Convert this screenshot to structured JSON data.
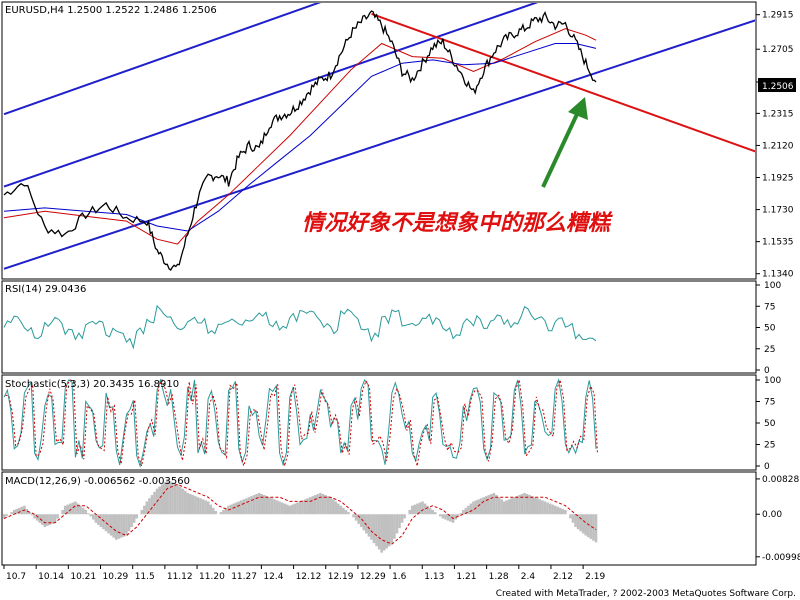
{
  "chart_data": [
    {
      "type": "candlestick",
      "title": "EURUSD,H4  1.2500 1.2522 1.2486 1.2506",
      "symbol": "EURUSD",
      "timeframe": "H4",
      "ohlc_last": {
        "open": 1.25,
        "high": 1.2522,
        "low": 1.2486,
        "close": 1.2506
      },
      "current_price_label": "1.2506",
      "current_price": 1.2506,
      "y_ticks": [
        "1.2915",
        "1.2705",
        "1.2506",
        "1.2315",
        "1.2120",
        "1.1925",
        "1.1730",
        "1.1535",
        "1.1340"
      ],
      "y_tick_values": [
        1.2915,
        1.2705,
        1.2506,
        1.2315,
        1.212,
        1.1925,
        1.173,
        1.1535,
        1.134
      ],
      "ylim": [
        1.132,
        1.298
      ],
      "x_ticks": [
        "10.7",
        "10.14",
        "10.21",
        "10.29",
        "11.5",
        "11.12",
        "11.20",
        "11.27",
        "12.4",
        "12.12",
        "12.19",
        "12.29",
        "1.6",
        "1.13",
        "1.21",
        "1.28",
        "2.4",
        "2.12",
        "2.19"
      ],
      "close_path": [
        [
          0,
          1.182
        ],
        [
          2,
          1.19
        ],
        [
          4,
          1.162
        ],
        [
          6,
          1.158
        ],
        [
          8,
          1.17
        ],
        [
          10,
          1.176
        ],
        [
          12,
          1.168
        ],
        [
          14,
          1.166
        ],
        [
          15,
          1.148
        ],
        [
          16,
          1.14
        ],
        [
          17,
          1.137
        ],
        [
          18,
          1.158
        ],
        [
          19,
          1.18
        ],
        [
          20,
          1.193
        ],
        [
          21,
          1.194
        ],
        [
          22,
          1.19
        ],
        [
          23,
          1.205
        ],
        [
          24,
          1.212
        ],
        [
          25,
          1.21
        ],
        [
          26,
          1.225
        ],
        [
          27,
          1.23
        ],
        [
          28,
          1.232
        ],
        [
          29,
          1.238
        ],
        [
          30,
          1.246
        ],
        [
          31,
          1.252
        ],
        [
          32,
          1.255
        ],
        [
          33,
          1.268
        ],
        [
          34,
          1.28
        ],
        [
          35,
          1.287
        ],
        [
          36,
          1.292
        ],
        [
          37,
          1.285
        ],
        [
          38,
          1.274
        ],
        [
          39,
          1.257
        ],
        [
          40,
          1.252
        ],
        [
          41,
          1.262
        ],
        [
          42,
          1.272
        ],
        [
          43,
          1.275
        ],
        [
          44,
          1.264
        ],
        [
          45,
          1.254
        ],
        [
          46,
          1.244
        ],
        [
          47,
          1.258
        ],
        [
          48,
          1.269
        ],
        [
          49,
          1.276
        ],
        [
          50,
          1.28
        ],
        [
          51,
          1.283
        ],
        [
          52,
          1.288
        ],
        [
          53,
          1.29
        ],
        [
          54,
          1.285
        ],
        [
          55,
          1.286
        ],
        [
          56,
          1.275
        ],
        [
          57,
          1.262
        ],
        [
          58,
          1.2506
        ]
      ],
      "ma_red": [
        [
          0,
          1.168
        ],
        [
          4,
          1.172
        ],
        [
          8,
          1.169
        ],
        [
          12,
          1.166
        ],
        [
          15,
          1.155
        ],
        [
          17,
          1.152
        ],
        [
          19,
          1.166
        ],
        [
          22,
          1.182
        ],
        [
          25,
          1.2
        ],
        [
          28,
          1.218
        ],
        [
          31,
          1.238
        ],
        [
          34,
          1.258
        ],
        [
          37,
          1.274
        ],
        [
          40,
          1.266
        ],
        [
          43,
          1.265
        ],
        [
          46,
          1.257
        ],
        [
          49,
          1.265
        ],
        [
          52,
          1.275
        ],
        [
          55,
          1.283
        ],
        [
          57,
          1.279
        ],
        [
          58,
          1.276
        ]
      ],
      "ma_blue": [
        [
          0,
          1.172
        ],
        [
          4,
          1.174
        ],
        [
          8,
          1.172
        ],
        [
          12,
          1.17
        ],
        [
          15,
          1.163
        ],
        [
          18,
          1.16
        ],
        [
          21,
          1.172
        ],
        [
          24,
          1.188
        ],
        [
          27,
          1.203
        ],
        [
          30,
          1.218
        ],
        [
          33,
          1.236
        ],
        [
          36,
          1.254
        ],
        [
          39,
          1.262
        ],
        [
          42,
          1.264
        ],
        [
          45,
          1.261
        ],
        [
          48,
          1.262
        ],
        [
          51,
          1.268
        ],
        [
          54,
          1.274
        ],
        [
          56,
          1.274
        ],
        [
          58,
          1.271
        ]
      ],
      "trend_channel_blue": {
        "lower": [
          [
            0,
            1.137
          ],
          [
            76,
            1.293
          ]
        ],
        "middle": [
          [
            0,
            1.187
          ],
          [
            76,
            1.35
          ]
        ],
        "upper": [
          [
            0,
            1.231
          ],
          [
            76,
            1.398
          ]
        ]
      },
      "trend_line_red": [
        [
          36,
          1.292
        ],
        [
          76,
          1.203
        ]
      ],
      "annotation": "情况好象不是想象中的那么糟糕",
      "arrow_color": "#2a8a2a",
      "colors": {
        "price": "#000000",
        "ma_red": "#cc0000",
        "ma_blue": "#0000cc",
        "channel": "#1f1fcc",
        "trend": "#dd1111",
        "annotation": "#e01010"
      }
    },
    {
      "type": "line",
      "title": "RSI(14) 29.0436",
      "name": "RSI(14)",
      "value": 29.0436,
      "y_ticks": [
        "100",
        "75",
        "50",
        "25",
        "0"
      ],
      "ylim": [
        0,
        100
      ],
      "values": [
        52,
        62,
        50,
        40,
        55,
        60,
        48,
        42,
        58,
        52,
        45,
        40,
        32,
        48,
        58,
        70,
        60,
        52,
        62,
        55,
        48,
        58,
        62,
        55,
        58,
        65,
        54,
        50,
        62,
        70,
        66,
        55,
        48,
        72,
        66,
        48,
        40,
        60,
        65,
        55,
        50,
        62,
        58,
        48,
        42,
        60,
        58,
        52,
        62,
        55,
        60,
        70,
        65,
        52,
        60,
        55,
        42,
        35,
        29
      ],
      "color": "#2a9a9a"
    },
    {
      "type": "line",
      "title": "Stochastic(5,3,3) 20.3435 16.8910",
      "name": "Stochastic(5,3,3)",
      "main": 20.3435,
      "signal": 16.891,
      "y_ticks": [
        "100",
        "75",
        "50",
        "25",
        "0"
      ],
      "ylim": [
        0,
        100
      ],
      "values": [
        80,
        20,
        85,
        15,
        70,
        25,
        90,
        10,
        75,
        30,
        85,
        18,
        60,
        12,
        40,
        88,
        70,
        22,
        92,
        15,
        78,
        28,
        88,
        20,
        70,
        35,
        90,
        15,
        80,
        25,
        60,
        88,
        45,
        15,
        70,
        90,
        30,
        20,
        85,
        60,
        15,
        40,
        80,
        25,
        10,
        70,
        90,
        20,
        85,
        30,
        88,
        15,
        75,
        40,
        90,
        25,
        15,
        80,
        20
      ],
      "colors": {
        "main": "#2a9a9a",
        "signal": "#cc0000"
      }
    },
    {
      "type": "bar",
      "title": "MACD(12,26,9) -0.006562 -0.003560",
      "name": "MACD(12,26,9)",
      "macd": -0.006562,
      "signal": -0.00356,
      "y_ticks": [
        "0.00828",
        "0.00",
        "-0.00998"
      ],
      "ylim": [
        -0.0112,
        0.0092
      ],
      "values": [
        -0.001,
        0.001,
        0.002,
        -0.001,
        -0.003,
        -0.002,
        0.002,
        0.003,
        0.001,
        -0.002,
        -0.004,
        -0.006,
        -0.005,
        -0.001,
        0.003,
        0.006,
        0.008,
        0.007,
        0.005,
        0.004,
        0.003,
        0.0,
        0.002,
        0.003,
        0.004,
        0.005,
        0.004,
        0.003,
        0.002,
        0.003,
        0.004,
        0.005,
        0.004,
        0.002,
        0.0,
        -0.003,
        -0.006,
        -0.009,
        -0.007,
        -0.002,
        0.002,
        0.003,
        0.001,
        -0.001,
        -0.002,
        0.001,
        0.003,
        0.004,
        0.005,
        0.003,
        0.004,
        0.005,
        0.004,
        0.003,
        0.002,
        0.001,
        -0.003,
        -0.005,
        -0.0066
      ],
      "signal_values": [
        -0.001,
        0.0,
        0.001,
        0.0,
        -0.002,
        -0.002,
        0.0,
        0.002,
        0.002,
        0.0,
        -0.002,
        -0.004,
        -0.005,
        -0.003,
        0.0,
        0.003,
        0.006,
        0.007,
        0.006,
        0.005,
        0.004,
        0.002,
        0.001,
        0.002,
        0.003,
        0.004,
        0.004,
        0.004,
        0.003,
        0.003,
        0.003,
        0.004,
        0.004,
        0.003,
        0.001,
        -0.001,
        -0.004,
        -0.006,
        -0.007,
        -0.005,
        -0.001,
        0.001,
        0.002,
        0.001,
        -0.001,
        0.0,
        0.001,
        0.003,
        0.004,
        0.004,
        0.004,
        0.004,
        0.004,
        0.004,
        0.003,
        0.002,
        0.0,
        -0.002,
        -0.0036
      ],
      "colors": {
        "histogram": "#c0c0c0",
        "signal": "#cc0000"
      }
    }
  ],
  "footer": "Created with MetaTrader, ? 2002-2003 MetaQuotes Software Corp."
}
